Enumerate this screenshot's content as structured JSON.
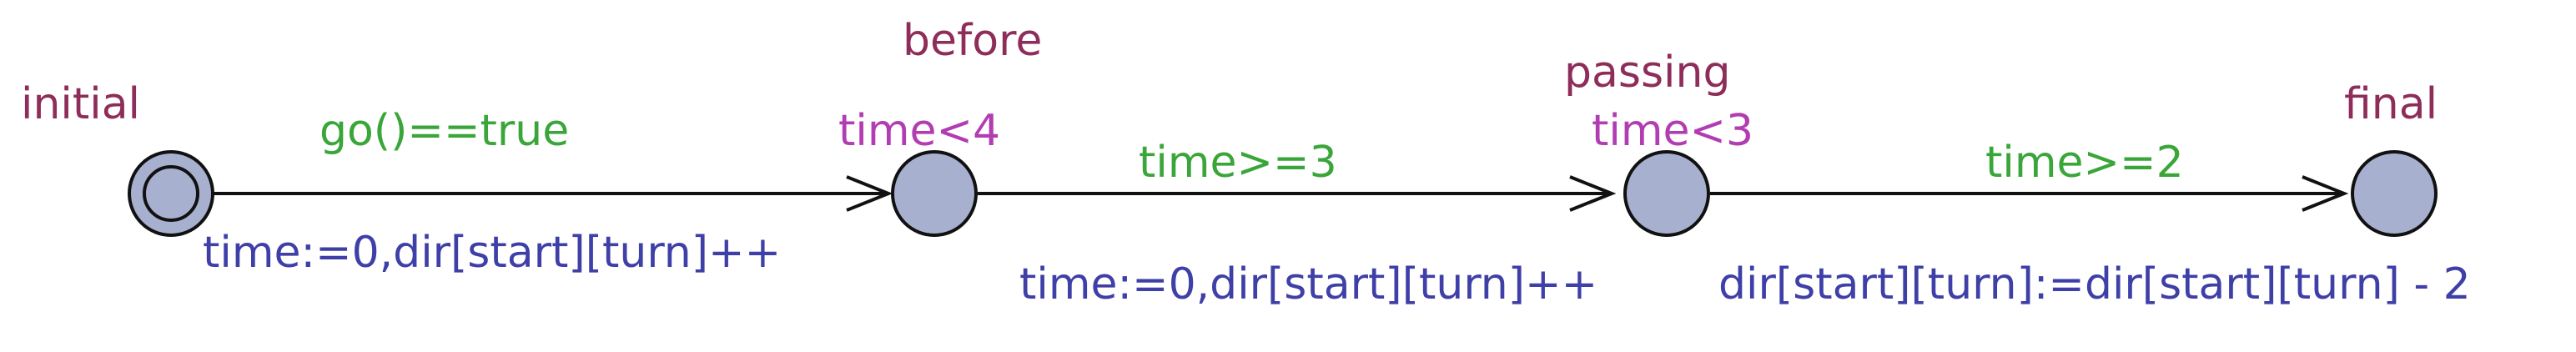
{
  "colors": {
    "location_name": "#8e2d5a",
    "invariant": "#b23cb2",
    "guard": "#3aa63a",
    "update": "#3f3fa8",
    "state_fill": "#a8b0d0",
    "stroke": "#111111"
  },
  "locations": [
    {
      "id": "initial",
      "name": "initial",
      "invariant": "",
      "is_initial": true
    },
    {
      "id": "before",
      "name": "before",
      "invariant": "time<4",
      "is_initial": false
    },
    {
      "id": "passing",
      "name": "passing",
      "invariant": "time<3",
      "is_initial": false
    },
    {
      "id": "final",
      "name": "final",
      "invariant": "",
      "is_initial": false
    }
  ],
  "transitions": [
    {
      "from": "initial",
      "to": "before",
      "guard": "go()==true",
      "update": "time:=0,dir[start][turn]++"
    },
    {
      "from": "before",
      "to": "passing",
      "guard": "time>=3",
      "update": "time:=0,dir[start][turn]++"
    },
    {
      "from": "passing",
      "to": "final",
      "guard": "time>=2",
      "update": "dir[start][turn]:=dir[start][turn] - 2"
    }
  ]
}
